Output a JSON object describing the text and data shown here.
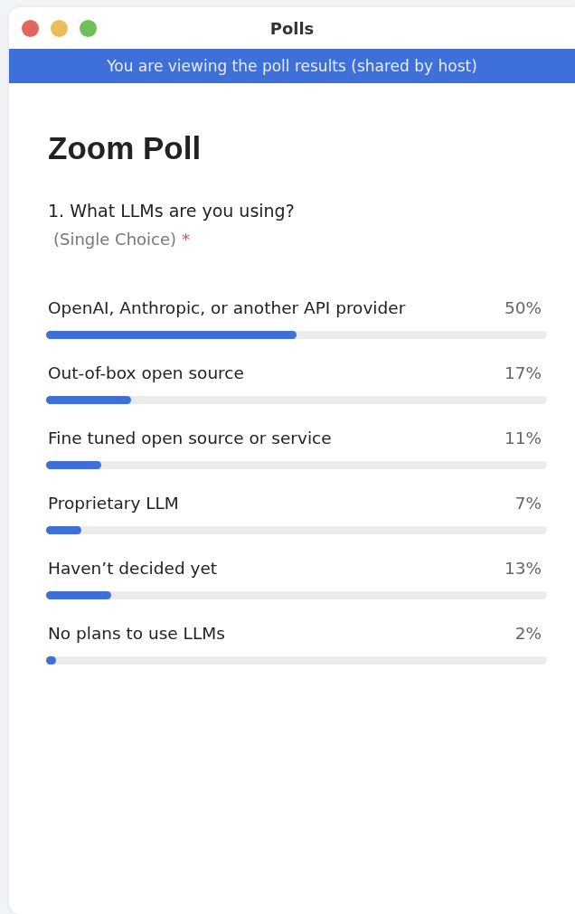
{
  "window": {
    "title": "Polls"
  },
  "banner": "You are viewing the poll results (shared by host)",
  "poll": {
    "title": "Zoom Poll",
    "question": "1. What LLMs are you using?",
    "question_type": "(Single Choice)",
    "required_mark": "*",
    "options": [
      {
        "label": "OpenAI, Anthropic, or another API provider",
        "percent": "50%",
        "level": 0.5
      },
      {
        "label": "Out-of-box open source",
        "percent": "17%",
        "level": 0.17
      },
      {
        "label": "Fine tuned open source or service",
        "percent": "11%",
        "level": 0.11
      },
      {
        "label": "Proprietary LLM",
        "percent": "7%",
        "level": 0.07
      },
      {
        "label": "Haven’t decided yet",
        "percent": "13%",
        "level": 0.13
      },
      {
        "label": "No plans to use LLMs",
        "percent": "2%",
        "level": 0.02
      }
    ]
  }
}
